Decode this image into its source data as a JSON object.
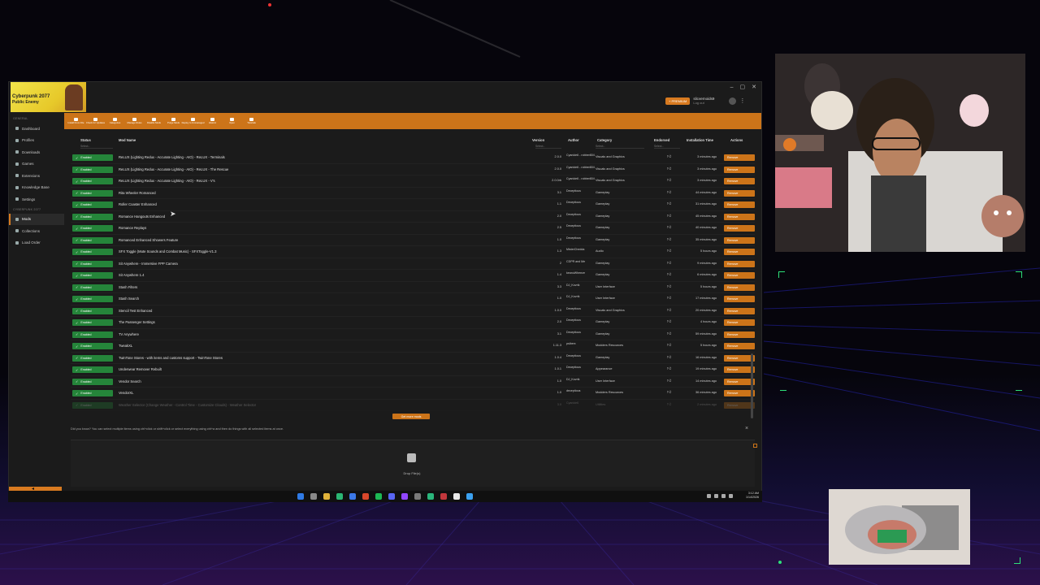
{
  "sidebar": {
    "section_general": "GENERAL",
    "items_general": [
      {
        "label": "Dashboard",
        "icon": "dashboard-icon",
        "active": false
      },
      {
        "label": "Profiles",
        "icon": "profile-icon",
        "active": false
      },
      {
        "label": "Downloads",
        "icon": "download-icon",
        "active": false
      },
      {
        "label": "Games",
        "icon": "gamepad-icon",
        "active": false
      },
      {
        "label": "Extensions",
        "icon": "puzzle-icon",
        "active": false
      },
      {
        "label": "Knowledge Base",
        "icon": "book-icon",
        "active": false
      },
      {
        "label": "Settings",
        "icon": "gear-icon",
        "active": false
      }
    ],
    "section_game": "CYBERPUNK 2077",
    "items_game": [
      {
        "label": "Mods",
        "icon": "mods-icon",
        "active": true
      },
      {
        "label": "Collections",
        "icon": "collections-icon",
        "active": false
      },
      {
        "label": "Load Order",
        "icon": "list-icon",
        "active": false
      }
    ]
  },
  "logo": {
    "line1": "Cyberpunk 2077",
    "line2": "Public Enemy"
  },
  "header": {
    "premium_label": "+ PREMIUM",
    "user_name": "slicvernoids9",
    "user_sub": "Log out"
  },
  "toolbar": {
    "tools": [
      {
        "label": "Install From File",
        "icon": "install-icon"
      },
      {
        "label": "Check for Updates",
        "icon": "refresh-icon"
      },
      {
        "label": "Categories",
        "icon": "categories-icon"
      },
      {
        "label": "Manage Rules",
        "icon": "rules-icon"
      },
      {
        "label": "Disable Mods",
        "icon": "disable-icon"
      },
      {
        "label": "Purge Mods",
        "icon": "purge-icon"
      },
      {
        "label": "Deploy to Unmanaged",
        "icon": "deploy-icon"
      },
      {
        "label": "Historic",
        "icon": "history-icon"
      },
      {
        "label": "Open",
        "icon": "folder-icon"
      },
      {
        "label": "Tutorials",
        "icon": "tutorial-icon"
      }
    ]
  },
  "table": {
    "columns": {
      "status": "Status",
      "mod_name": "Mod Name",
      "version": "Version",
      "author": "Author",
      "category": "Category",
      "endorsed": "Endorsed",
      "installation_time": "Installation Time",
      "actions": "Actions"
    },
    "filter_placeholder": "Select...",
    "status_label": "Enabled",
    "remove_label": "Remove",
    "rows": [
      {
        "name": "ReLUX (Lighting Redux - Accurate Lighting - AIO) - ReLUX - Terminals",
        "version": "2.0.0",
        "author": "Cyanide6 - robber804",
        "category": "Visuals and Graphics",
        "time": "3 minutes ago"
      },
      {
        "name": "ReLUX (Lighting Redux - Accurate Lighting - AIO) - ReLUX - The Rescue",
        "version": "2.0.0",
        "author": "Cyanide6 - robber804",
        "category": "Visuals and Graphics",
        "time": "3 minutes ago"
      },
      {
        "name": "ReLUX (Lighting Redux - Accurate Lighting - AIO) - ReLUX - V's",
        "version": "2.0.0rb",
        "author": "Cyanide6 - robber804",
        "category": "Visuals and Graphics",
        "time": "3 minutes ago"
      },
      {
        "name": "Rita Wheeler Romanced",
        "version": "3.1",
        "author": "Deceptious",
        "category": "Gameplay",
        "time": "44 minutes ago"
      },
      {
        "name": "Roller Coaster Enhanced",
        "version": "1.1",
        "author": "Deceptious",
        "category": "Gameplay",
        "time": "31 minutes ago"
      },
      {
        "name": "Romance Hangouts Enhanced",
        "version": "2.0",
        "author": "Deceptious",
        "category": "Gameplay",
        "time": "45 minutes ago"
      },
      {
        "name": "Romance Replays",
        "version": "2.5",
        "author": "Deceptious",
        "category": "Gameplay",
        "time": "40 minutes ago"
      },
      {
        "name": "Romanced Enhanced Showers Feature",
        "version": "1.0",
        "author": "Deceptious",
        "category": "Gameplay",
        "time": "35 minutes ago"
      },
      {
        "name": "SFX Toggle (Mute Sounds and Combat Music) - SFXToggle-V1.3",
        "version": "1.3",
        "author": "MisterChedda",
        "category": "Audio",
        "time": "5 hours ago"
      },
      {
        "name": "Sit Anywhere - Immersive FPP Camera",
        "version": "2",
        "author": "CDPR and Me",
        "category": "Gameplay",
        "time": "9 minutes ago"
      },
      {
        "name": "Sit Anywhere 1.4",
        "version": "1.4",
        "author": "keanuWheeze",
        "category": "Gameplay",
        "time": "6 minutes ago"
      },
      {
        "name": "Stash Filters",
        "version": "3.3",
        "author": "DJ_Kovrik",
        "category": "User Interface",
        "time": "5 hours ago"
      },
      {
        "name": "Stash Search",
        "version": "1.0",
        "author": "DJ_Kovrik",
        "category": "User Interface",
        "time": "17 minutes ago"
      },
      {
        "name": "Stencil Test Enhanced",
        "version": "1.0.0",
        "author": "Deceptious",
        "category": "Visuals and Graphics",
        "time": "20 minutes ago"
      },
      {
        "name": "The Passenger Settings",
        "version": "2.0",
        "author": "Deceptious",
        "category": "Gameplay",
        "time": "4 hours ago"
      },
      {
        "name": "TV Anywhere",
        "version": "3.1",
        "author": "Deceptious",
        "category": "Gameplay",
        "time": "59 minutes ago"
      },
      {
        "name": "TweakXL",
        "version": "1.11.3",
        "author": "psiberx",
        "category": "Modders Resources",
        "time": "5 hours ago"
      },
      {
        "name": "TwinTone Stores - with items and customs support - TwinTone Stores",
        "version": "1.0.4",
        "author": "Deceptious",
        "category": "Gameplay",
        "time": "16 minutes ago"
      },
      {
        "name": "Underwear Remover Rebuilt",
        "version": "1.0.1",
        "author": "Deceptious",
        "category": "Appearance",
        "time": "19 minutes ago"
      },
      {
        "name": "Vendor Search",
        "version": "1.0",
        "author": "DJ_Kovrik",
        "category": "User Interface",
        "time": "14 minutes ago"
      },
      {
        "name": "VendorXL",
        "version": "1.0",
        "author": "deceptious",
        "category": "Modders Resources",
        "time": "36 minutes ago"
      },
      {
        "name": "Weather Selector (Change Weather - Control Time - Customize Clouds) - Weather Selector",
        "version": "3.0",
        "author": "Cyanide6",
        "category": "Utilities",
        "time": "2 minutes ago"
      }
    ]
  },
  "get_more_label": "Get more mods",
  "tip_text": "Did you know? You can select multiple items using ctrl+click or shift+click or select everything using ctrl+a and then do things with all selected items at once.",
  "drop_label": "Drop File(s)",
  "clock": {
    "time": "3:12 AM",
    "date": "1/14/2026"
  },
  "colors": {
    "accent": "#cc7419",
    "enabled": "#25853a"
  }
}
